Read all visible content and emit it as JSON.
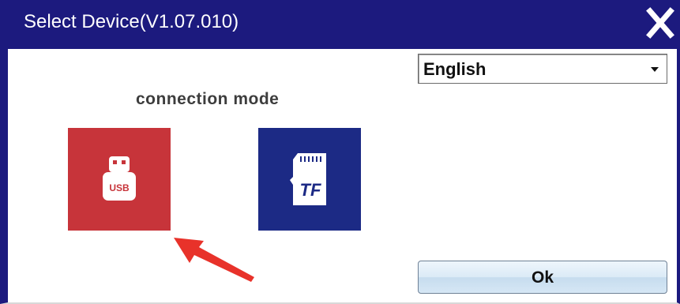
{
  "window": {
    "title": "Select Device(V1.07.010)",
    "close_icon": "close-icon"
  },
  "language": {
    "selected": "English",
    "dropdown_icon": "chevron-down-icon"
  },
  "connection": {
    "label": "connection mode",
    "modes": [
      {
        "name": "USB",
        "icon_text": "USB",
        "color": "#c7343a"
      },
      {
        "name": "TF",
        "icon_text": "TF",
        "color": "#1c2a85"
      }
    ]
  },
  "annotation": {
    "color": "#e8322a"
  },
  "actions": {
    "ok_label": "Ok"
  }
}
